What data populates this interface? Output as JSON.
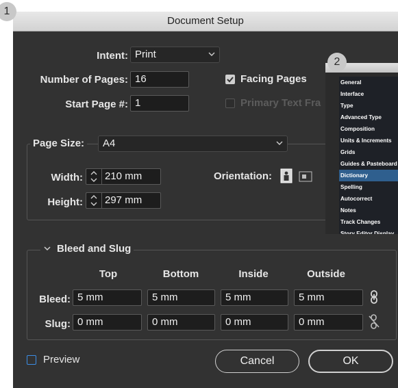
{
  "badges": {
    "one": "1",
    "two": "2"
  },
  "dialog": {
    "title": "Document Setup",
    "intent_label": "Intent:",
    "intent_value": "Print",
    "pages_label": "Number of Pages:",
    "pages_value": "16",
    "start_label": "Start Page #:",
    "start_value": "1",
    "facing_label": "Facing Pages",
    "facing_checked": true,
    "primary_label": "Primary Text Fra",
    "primary_checked": false,
    "pagesize_label": "Page Size:",
    "pagesize_value": "A4",
    "width_label": "Width:",
    "width_value": "210 mm",
    "height_label": "Height:",
    "height_value": "297 mm",
    "orientation_label": "Orientation:",
    "bleed_section": "Bleed and Slug",
    "columns": [
      "Top",
      "Bottom",
      "Inside",
      "Outside"
    ],
    "bleed_label": "Bleed:",
    "bleed_values": [
      "5 mm",
      "5 mm",
      "5 mm",
      "5 mm"
    ],
    "slug_label": "Slug:",
    "slug_values": [
      "0 mm",
      "0 mm",
      "0 mm",
      "0 mm"
    ],
    "preview_label": "Preview",
    "cancel_label": "Cancel",
    "ok_label": "OK",
    "accent": "#3c8ee6"
  },
  "preferences_list": {
    "items": [
      "General",
      "Interface",
      "Type",
      "Advanced Type",
      "Composition",
      "Units & Increments",
      "Grids",
      "Guides & Pasteboard",
      "Dictionary",
      "Spelling",
      "Autocorrect",
      "Notes",
      "Track Changes",
      "Story Editor Display"
    ],
    "selected": "Dictionary",
    "selected_color": "#2f5f8e"
  }
}
